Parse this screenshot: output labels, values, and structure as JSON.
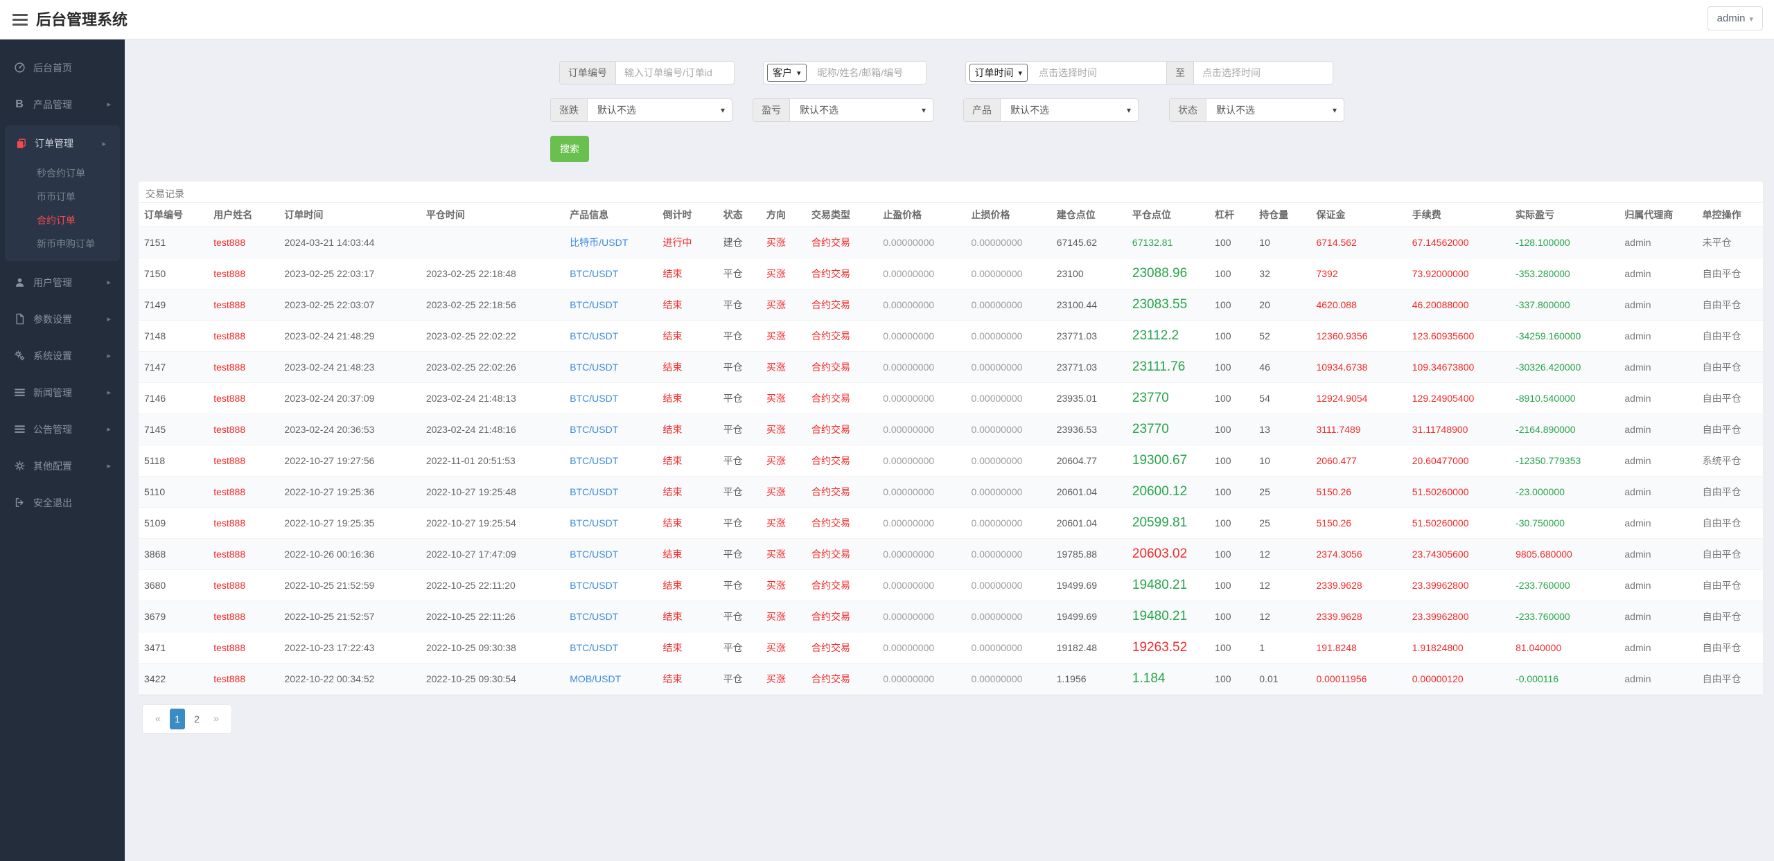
{
  "topbar": {
    "title": "后台管理系统",
    "user": "admin"
  },
  "colors": {
    "red": "#f42a2a",
    "green": "#26a44a",
    "link_blue": "#3e8bdf",
    "search_button_green": "#6ac04f",
    "active_page_blue": "#3b8cc4",
    "sidebar_bg": "#232d3c",
    "sidebar_active_red": "#f34b4b"
  },
  "sidebar": {
    "items": [
      {
        "label": "后台首页",
        "icon": "dashboard-icon"
      },
      {
        "label": "产品管理",
        "icon": "bitcoin-icon",
        "arrow": "▸"
      },
      {
        "label": "订单管理",
        "icon": "orders-icon",
        "arrow": "▸",
        "active": true,
        "children": [
          {
            "label": "秒合约订单"
          },
          {
            "label": "币币订单"
          },
          {
            "label": "合约订单",
            "active": true
          },
          {
            "label": "新币申购订单"
          }
        ]
      },
      {
        "label": "用户管理",
        "icon": "users-icon",
        "arrow": "▸"
      },
      {
        "label": "参数设置",
        "icon": "file-icon",
        "arrow": "▸"
      },
      {
        "label": "系统设置",
        "icon": "gears-icon",
        "arrow": "▸"
      },
      {
        "label": "新闻管理",
        "icon": "list-icon",
        "arrow": "▸"
      },
      {
        "label": "公告管理",
        "icon": "list-icon",
        "arrow": "▸"
      },
      {
        "label": "其他配置",
        "icon": "gear-icon",
        "arrow": "▸"
      },
      {
        "label": "安全退出",
        "icon": "logout-icon"
      }
    ]
  },
  "filters": {
    "order_no_label": "订单编号",
    "order_no_placeholder": "输入订单编号/订单id",
    "customer_select": "客户",
    "customer_placeholder": "昵称/姓名/邮箱/编号",
    "time_select": "订单时间",
    "time_from_placeholder": "点击选择时间",
    "to_label": "至",
    "time_to_placeholder": "点击选择时间",
    "updown_label": "涨跌",
    "updown_value": "默认不选",
    "pnl_label": "盈亏",
    "pnl_value": "默认不选",
    "product_label": "产品",
    "product_value": "默认不选",
    "status_label": "状态",
    "status_value": "默认不选",
    "search_label": "搜索"
  },
  "panel": {
    "title": "交易记录"
  },
  "table": {
    "columns": [
      "订单编号",
      "用户姓名",
      "订单时间",
      "平仓时间",
      "产品信息",
      "倒计时",
      "状态",
      "方向",
      "交易类型",
      "止盈价格",
      "止损价格",
      "建仓点位",
      "平仓点位",
      "杠杆",
      "持仓量",
      "保证金",
      "手续费",
      "实际盈亏",
      "归属代理商",
      "单控操作"
    ],
    "rows": [
      {
        "id": "7151",
        "user": "test888",
        "open_time": "2024-03-21 14:03:44",
        "close_time": "",
        "product": "比特币/USDT",
        "countdown": "进行中",
        "state": "建仓",
        "direction": "买涨",
        "trade_type": "合约交易",
        "take_profit": "0.00000000",
        "stop_loss": "0.00000000",
        "open_price": "67145.62",
        "close_price": "67132.81",
        "close_trend": "down",
        "live": true,
        "leverage": "100",
        "volume": "10",
        "margin": "6714.562",
        "fee": "67.14562000",
        "profit": "-128.100000",
        "agent": "admin",
        "control": "未平仓"
      },
      {
        "id": "7150",
        "user": "test888",
        "open_time": "2023-02-25 22:03:17",
        "close_time": "2023-02-25 22:18:48",
        "product": "BTC/USDT",
        "countdown": "结束",
        "state": "平仓",
        "direction": "买涨",
        "trade_type": "合约交易",
        "take_profit": "0.00000000",
        "stop_loss": "0.00000000",
        "open_price": "23100",
        "close_price": "23088.96",
        "close_trend": "down",
        "leverage": "100",
        "volume": "32",
        "margin": "7392",
        "fee": "73.92000000",
        "profit": "-353.280000",
        "agent": "admin",
        "control": "自由平仓"
      },
      {
        "id": "7149",
        "user": "test888",
        "open_time": "2023-02-25 22:03:07",
        "close_time": "2023-02-25 22:18:56",
        "product": "BTC/USDT",
        "countdown": "结束",
        "state": "平仓",
        "direction": "买涨",
        "trade_type": "合约交易",
        "take_profit": "0.00000000",
        "stop_loss": "0.00000000",
        "open_price": "23100.44",
        "close_price": "23083.55",
        "close_trend": "down",
        "leverage": "100",
        "volume": "20",
        "margin": "4620.088",
        "fee": "46.20088000",
        "profit": "-337.800000",
        "agent": "admin",
        "control": "自由平仓"
      },
      {
        "id": "7148",
        "user": "test888",
        "open_time": "2023-02-24 21:48:29",
        "close_time": "2023-02-25 22:02:22",
        "product": "BTC/USDT",
        "countdown": "结束",
        "state": "平仓",
        "direction": "买涨",
        "trade_type": "合约交易",
        "take_profit": "0.00000000",
        "stop_loss": "0.00000000",
        "open_price": "23771.03",
        "close_price": "23112.2",
        "close_trend": "down",
        "leverage": "100",
        "volume": "52",
        "margin": "12360.9356",
        "fee": "123.60935600",
        "profit": "-34259.160000",
        "agent": "admin",
        "control": "自由平仓"
      },
      {
        "id": "7147",
        "user": "test888",
        "open_time": "2023-02-24 21:48:23",
        "close_time": "2023-02-25 22:02:26",
        "product": "BTC/USDT",
        "countdown": "结束",
        "state": "平仓",
        "direction": "买涨",
        "trade_type": "合约交易",
        "take_profit": "0.00000000",
        "stop_loss": "0.00000000",
        "open_price": "23771.03",
        "close_price": "23111.76",
        "close_trend": "down",
        "leverage": "100",
        "volume": "46",
        "margin": "10934.6738",
        "fee": "109.34673800",
        "profit": "-30326.420000",
        "agent": "admin",
        "control": "自由平仓"
      },
      {
        "id": "7146",
        "user": "test888",
        "open_time": "2023-02-24 20:37:09",
        "close_time": "2023-02-24 21:48:13",
        "product": "BTC/USDT",
        "countdown": "结束",
        "state": "平仓",
        "direction": "买涨",
        "trade_type": "合约交易",
        "take_profit": "0.00000000",
        "stop_loss": "0.00000000",
        "open_price": "23935.01",
        "close_price": "23770",
        "close_trend": "down",
        "leverage": "100",
        "volume": "54",
        "margin": "12924.9054",
        "fee": "129.24905400",
        "profit": "-8910.540000",
        "agent": "admin",
        "control": "自由平仓"
      },
      {
        "id": "7145",
        "user": "test888",
        "open_time": "2023-02-24 20:36:53",
        "close_time": "2023-02-24 21:48:16",
        "product": "BTC/USDT",
        "countdown": "结束",
        "state": "平仓",
        "direction": "买涨",
        "trade_type": "合约交易",
        "take_profit": "0.00000000",
        "stop_loss": "0.00000000",
        "open_price": "23936.53",
        "close_price": "23770",
        "close_trend": "down",
        "leverage": "100",
        "volume": "13",
        "margin": "3111.7489",
        "fee": "31.11748900",
        "profit": "-2164.890000",
        "agent": "admin",
        "control": "自由平仓"
      },
      {
        "id": "5118",
        "user": "test888",
        "open_time": "2022-10-27 19:27:56",
        "close_time": "2022-11-01 20:51:53",
        "product": "BTC/USDT",
        "countdown": "结束",
        "state": "平仓",
        "direction": "买涨",
        "trade_type": "合约交易",
        "take_profit": "0.00000000",
        "stop_loss": "0.00000000",
        "open_price": "20604.77",
        "close_price": "19300.67",
        "close_trend": "down",
        "leverage": "100",
        "volume": "10",
        "margin": "2060.477",
        "fee": "20.60477000",
        "profit": "-12350.779353",
        "agent": "admin",
        "control": "系统平仓"
      },
      {
        "id": "5110",
        "user": "test888",
        "open_time": "2022-10-27 19:25:36",
        "close_time": "2022-10-27 19:25:48",
        "product": "BTC/USDT",
        "countdown": "结束",
        "state": "平仓",
        "direction": "买涨",
        "trade_type": "合约交易",
        "take_profit": "0.00000000",
        "stop_loss": "0.00000000",
        "open_price": "20601.04",
        "close_price": "20600.12",
        "close_trend": "down",
        "leverage": "100",
        "volume": "25",
        "margin": "5150.26",
        "fee": "51.50260000",
        "profit": "-23.000000",
        "agent": "admin",
        "control": "自由平仓"
      },
      {
        "id": "5109",
        "user": "test888",
        "open_time": "2022-10-27 19:25:35",
        "close_time": "2022-10-27 19:25:54",
        "product": "BTC/USDT",
        "countdown": "结束",
        "state": "平仓",
        "direction": "买涨",
        "trade_type": "合约交易",
        "take_profit": "0.00000000",
        "stop_loss": "0.00000000",
        "open_price": "20601.04",
        "close_price": "20599.81",
        "close_trend": "down",
        "leverage": "100",
        "volume": "25",
        "margin": "5150.26",
        "fee": "51.50260000",
        "profit": "-30.750000",
        "agent": "admin",
        "control": "自由平仓"
      },
      {
        "id": "3868",
        "user": "test888",
        "open_time": "2022-10-26 00:16:36",
        "close_time": "2022-10-27 17:47:09",
        "product": "BTC/USDT",
        "countdown": "结束",
        "state": "平仓",
        "direction": "买涨",
        "trade_type": "合约交易",
        "take_profit": "0.00000000",
        "stop_loss": "0.00000000",
        "open_price": "19785.88",
        "close_price": "20603.02",
        "close_trend": "up",
        "leverage": "100",
        "volume": "12",
        "margin": "2374.3056",
        "fee": "23.74305600",
        "profit": "9805.680000",
        "agent": "admin",
        "control": "自由平仓"
      },
      {
        "id": "3680",
        "user": "test888",
        "open_time": "2022-10-25 21:52:59",
        "close_time": "2022-10-25 22:11:20",
        "product": "BTC/USDT",
        "countdown": "结束",
        "state": "平仓",
        "direction": "买涨",
        "trade_type": "合约交易",
        "take_profit": "0.00000000",
        "stop_loss": "0.00000000",
        "open_price": "19499.69",
        "close_price": "19480.21",
        "close_trend": "down",
        "leverage": "100",
        "volume": "12",
        "margin": "2339.9628",
        "fee": "23.39962800",
        "profit": "-233.760000",
        "agent": "admin",
        "control": "自由平仓"
      },
      {
        "id": "3679",
        "user": "test888",
        "open_time": "2022-10-25 21:52:57",
        "close_time": "2022-10-25 22:11:26",
        "product": "BTC/USDT",
        "countdown": "结束",
        "state": "平仓",
        "direction": "买涨",
        "trade_type": "合约交易",
        "take_profit": "0.00000000",
        "stop_loss": "0.00000000",
        "open_price": "19499.69",
        "close_price": "19480.21",
        "close_trend": "down",
        "leverage": "100",
        "volume": "12",
        "margin": "2339.9628",
        "fee": "23.39962800",
        "profit": "-233.760000",
        "agent": "admin",
        "control": "自由平仓"
      },
      {
        "id": "3471",
        "user": "test888",
        "open_time": "2022-10-23 17:22:43",
        "close_time": "2022-10-25 09:30:38",
        "product": "BTC/USDT",
        "countdown": "结束",
        "state": "平仓",
        "direction": "买涨",
        "trade_type": "合约交易",
        "take_profit": "0.00000000",
        "stop_loss": "0.00000000",
        "open_price": "19182.48",
        "close_price": "19263.52",
        "close_trend": "up",
        "leverage": "100",
        "volume": "1",
        "margin": "191.8248",
        "fee": "1.91824800",
        "profit": "81.040000",
        "agent": "admin",
        "control": "自由平仓"
      },
      {
        "id": "3422",
        "user": "test888",
        "open_time": "2022-10-22 00:34:52",
        "close_time": "2022-10-25 09:30:54",
        "product": "MOB/USDT",
        "countdown": "结束",
        "state": "平仓",
        "direction": "买涨",
        "trade_type": "合约交易",
        "take_profit": "0.00000000",
        "stop_loss": "0.00000000",
        "open_price": "1.1956",
        "close_price": "1.184",
        "close_trend": "down",
        "leverage": "100",
        "volume": "0.01",
        "margin": "0.00011956",
        "fee": "0.00000120",
        "profit": "-0.000116",
        "agent": "admin",
        "control": "自由平仓"
      }
    ]
  },
  "pagination": {
    "prev": "«",
    "pages": [
      "1",
      "2"
    ],
    "active": "1",
    "next": "»"
  }
}
